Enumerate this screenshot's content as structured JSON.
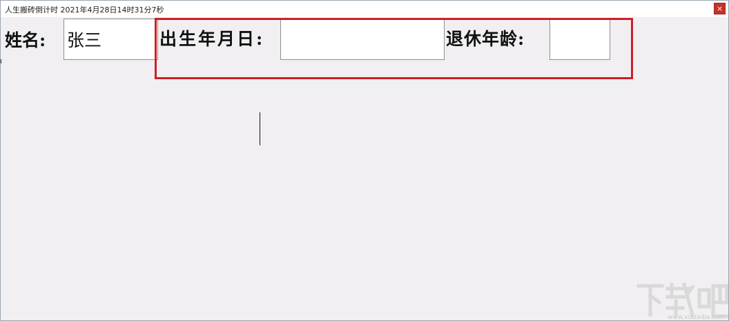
{
  "window": {
    "title": "人生搬砖倒计时 2021年4月28日14时31分7秒",
    "close_label": "×"
  },
  "form": {
    "name_label": "姓名:",
    "name_value": "张三",
    "birthdate_label": "出生年月日:",
    "birthdate_value": "",
    "retire_age_label": "退休年龄:",
    "retire_age_value": ""
  },
  "watermark": {
    "url_text": "www.xiazaiba.com"
  },
  "colors": {
    "highlight": "#cc1f25",
    "background": "#f1eff2",
    "close_button": "#c4312b"
  }
}
